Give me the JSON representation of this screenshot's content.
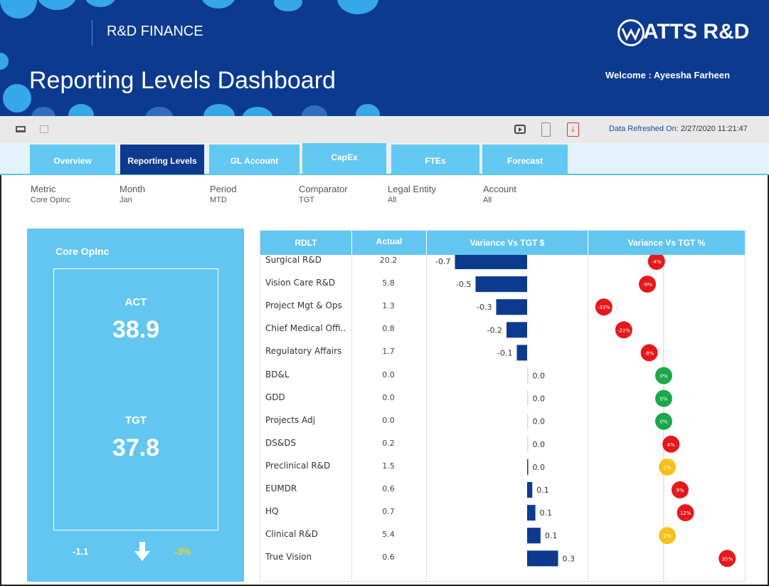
{
  "header": {
    "brand": "R&D FINANCE",
    "title": "Reporting Levels Dashboard",
    "logo_text": "ATTS R&D",
    "welcome": "Welcome : Ayeesha Farheen",
    "colors": {
      "header_bg": "#0c3a8f",
      "accent": "#63c6f0"
    }
  },
  "toolbar": {
    "refresh_label": "Data Refreshed On:",
    "refresh_value": "2/27/2020 11:21:47"
  },
  "tabs": [
    {
      "label": "Overview"
    },
    {
      "label": "Reporting Levels"
    },
    {
      "label": "GL Account"
    },
    {
      "label": "CapEx"
    },
    {
      "label": "FTEs"
    },
    {
      "label": "Forecast"
    }
  ],
  "filters": [
    {
      "label": "Metric",
      "value": "Core OpInc"
    },
    {
      "label": "Month",
      "value": "Jan"
    },
    {
      "label": "Period",
      "value": "MTD"
    },
    {
      "label": "Comparator",
      "value": "TGT"
    },
    {
      "label": "Legal Entity",
      "value": "All"
    },
    {
      "label": "Account",
      "value": "All"
    }
  ],
  "kpi": {
    "title": "Core OpInc",
    "act_label": "ACT",
    "act_value": "38.9",
    "tgt_label": "TGT",
    "tgt_value": "37.8",
    "variance": "-1.1",
    "variance_pct": "-3%"
  },
  "table": {
    "headers": [
      "RDLT",
      "Actual",
      "Variance Vs TGT $",
      "Variance Vs TGT %"
    ],
    "rows": [
      {
        "name": "Surgical R&D",
        "actual": "20.2",
        "var": -0.7,
        "var_label": "-0.7",
        "pct": -4,
        "pct_label": "-4%",
        "color": "#e5181b"
      },
      {
        "name": "Vision Care R&D",
        "actual": "5.8",
        "var": -0.5,
        "var_label": "-0.5",
        "pct": -9,
        "pct_label": "-9%",
        "color": "#e5181b"
      },
      {
        "name": "Project Mgt & Ops",
        "actual": "1.3",
        "var": -0.3,
        "var_label": "-0.3",
        "pct": -33,
        "pct_label": "-33%",
        "color": "#e5181b"
      },
      {
        "name": "Chief Medical Offi..",
        "actual": "0.8",
        "var": -0.2,
        "var_label": "-0.2",
        "pct": -22,
        "pct_label": "-22%",
        "color": "#e5181b"
      },
      {
        "name": "Regulatory Affairs",
        "actual": "1.7",
        "var": -0.1,
        "var_label": "-0.1",
        "pct": -8,
        "pct_label": "-8%",
        "color": "#e5181b"
      },
      {
        "name": "BD&L",
        "actual": "0.0",
        "var": 0.0,
        "var_label": "0.0",
        "pct": 0,
        "pct_label": "0%",
        "color": "#1aa84a"
      },
      {
        "name": "GDD",
        "actual": "0.0",
        "var": 0.0,
        "var_label": "0.0",
        "pct": 0,
        "pct_label": "0%",
        "color": "#1aa84a"
      },
      {
        "name": "Projects Adj",
        "actual": "0.0",
        "var": 0.0,
        "var_label": "0.0",
        "pct": 0,
        "pct_label": "0%",
        "color": "#1aa84a"
      },
      {
        "name": "DS&DS",
        "actual": "0.2",
        "var": 0.0,
        "var_label": "0.0",
        "pct": 4,
        "pct_label": "4%",
        "color": "#e5181b"
      },
      {
        "name": "Preclinical R&D",
        "actual": "1.5",
        "var": 0.01,
        "var_label": "0.0",
        "pct": 2,
        "pct_label": "2%",
        "color": "#f5c21a"
      },
      {
        "name": "EUMDR",
        "actual": "0.6",
        "var": 0.05,
        "var_label": "0.1",
        "pct": 9,
        "pct_label": "9%",
        "color": "#e5181b"
      },
      {
        "name": "HQ",
        "actual": "0.7",
        "var": 0.08,
        "var_label": "0.1",
        "pct": 12,
        "pct_label": "12%",
        "color": "#e5181b"
      },
      {
        "name": "Clinical R&D",
        "actual": "5.4",
        "var": 0.13,
        "var_label": "0.1",
        "pct": 2,
        "pct_label": "2%",
        "color": "#f5c21a"
      },
      {
        "name": "True Vision",
        "actual": "0.6",
        "var": 0.3,
        "var_label": "0.3",
        "pct": 35,
        "pct_label": "35%",
        "color": "#e5181b"
      }
    ]
  }
}
